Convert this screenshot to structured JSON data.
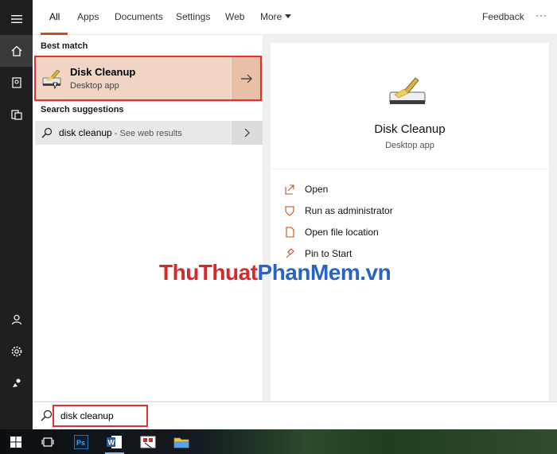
{
  "tabs": [
    {
      "label": "All"
    },
    {
      "label": "Apps"
    },
    {
      "label": "Documents"
    },
    {
      "label": "Settings"
    },
    {
      "label": "Web"
    },
    {
      "label": "More"
    }
  ],
  "feedback_label": "Feedback",
  "more_options_label": "···",
  "results": {
    "best_match_label": "Best match",
    "best_match": {
      "title": "Disk Cleanup",
      "subtitle": "Desktop app"
    },
    "suggestions_label": "Search suggestions",
    "suggestion": {
      "query": "disk cleanup",
      "hint": " - See web results"
    }
  },
  "preview": {
    "title": "Disk Cleanup",
    "subtitle": "Desktop app",
    "actions": [
      {
        "label": "Open",
        "icon": "open-icon"
      },
      {
        "label": "Run as administrator",
        "icon": "shield-icon"
      },
      {
        "label": "Open file location",
        "icon": "file-icon"
      },
      {
        "label": "Pin to Start",
        "icon": "pin-icon"
      }
    ]
  },
  "search": {
    "value": "disk cleanup"
  },
  "watermark": {
    "part1": "ThuThuat",
    "part2": "PhanMem",
    "part3": ".vn"
  },
  "colors": {
    "accent": "#c94f15",
    "highlight": "#f1d5c4",
    "outline": "#e23030"
  }
}
